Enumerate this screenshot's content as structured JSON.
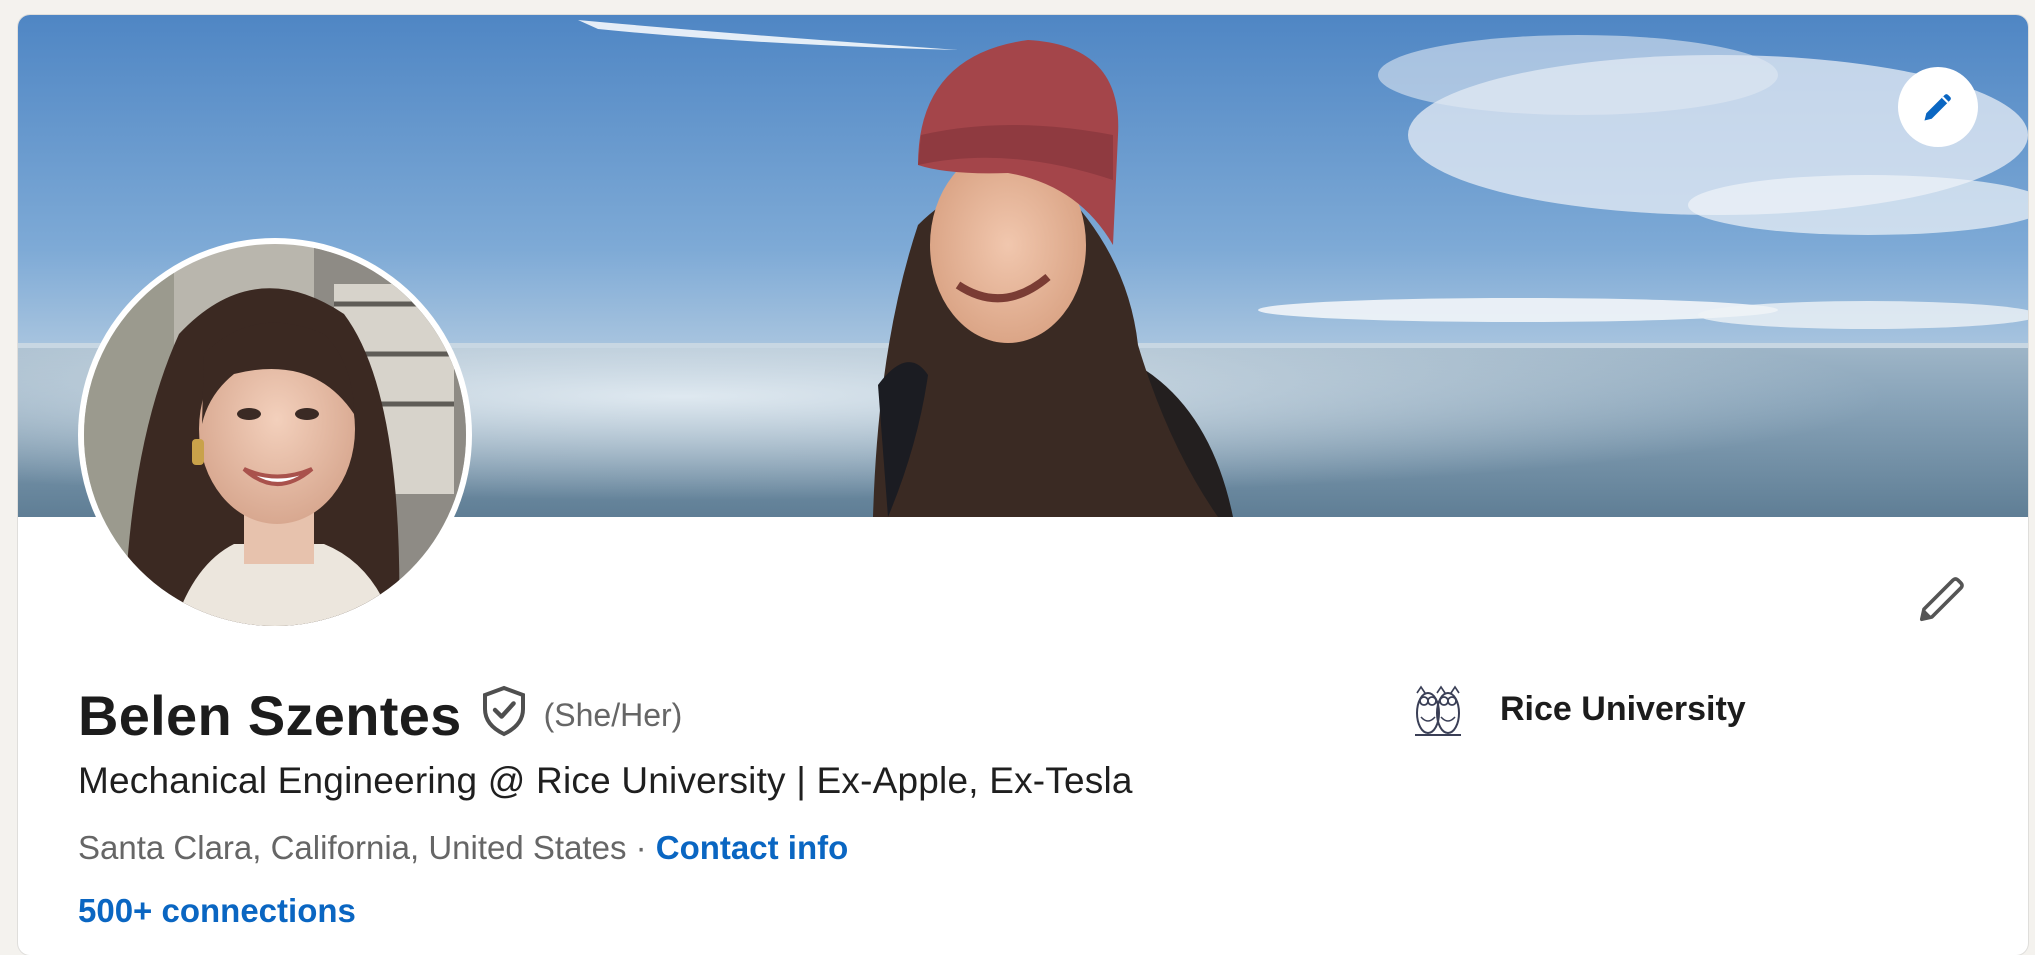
{
  "profile": {
    "name": "Belen Szentes",
    "pronouns": "(She/Her)",
    "headline": "Mechanical Engineering @ Rice University | Ex-Apple, Ex-Tesla",
    "location": "Santa Clara, California, United States",
    "separator": " · ",
    "contact_label": "Contact info",
    "connections_label": "500+ connections"
  },
  "education": {
    "school": "Rice University",
    "logo_icon": "owl-logo-icon"
  },
  "icons": {
    "banner_edit": "pencil-icon",
    "intro_edit": "pencil-icon",
    "verified": "shield-check-icon"
  },
  "colors": {
    "link": "#0a66c2",
    "text_primary": "#1c1c1c",
    "text_secondary": "#666666",
    "page_bg": "#f4f2ee",
    "sky": "#5b90c9",
    "sea": "#6f8ea6"
  }
}
